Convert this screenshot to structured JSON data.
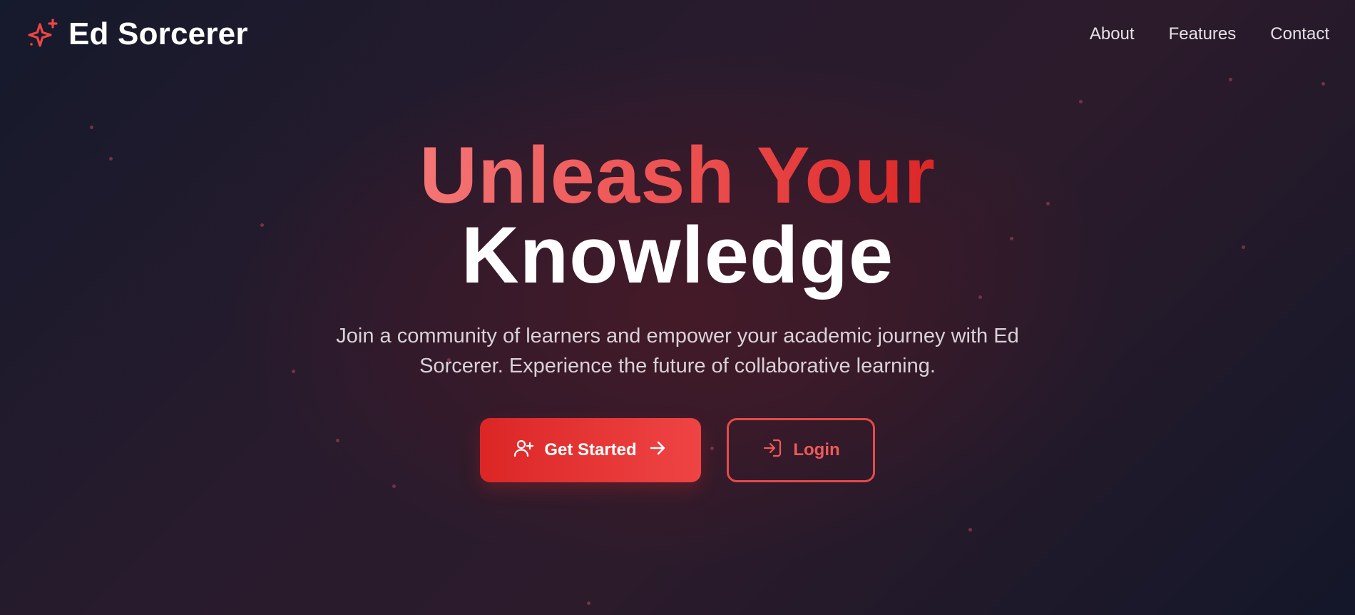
{
  "brand": {
    "name": "Ed Sorcerer",
    "icon": "sparkles-icon"
  },
  "nav": {
    "items": [
      {
        "label": "About"
      },
      {
        "label": "Features"
      },
      {
        "label": "Contact"
      }
    ]
  },
  "hero": {
    "title_line1": "Unleash Your",
    "title_line2": "Knowledge",
    "subtitle": "Join a community of learners and empower your academic journey with Ed Sorcerer. Experience the future of collaborative learning."
  },
  "actions": {
    "get_started": {
      "label": "Get Started",
      "icon": "user-plus-icon",
      "trailing_icon": "arrow-right-icon"
    },
    "login": {
      "label": "Login",
      "icon": "log-in-icon"
    }
  },
  "colors": {
    "accent": "#ef4444",
    "accent_dark": "#dc2626",
    "background": "#241b2c",
    "text": "#ffffff",
    "muted_text": "#d9d2d8"
  }
}
